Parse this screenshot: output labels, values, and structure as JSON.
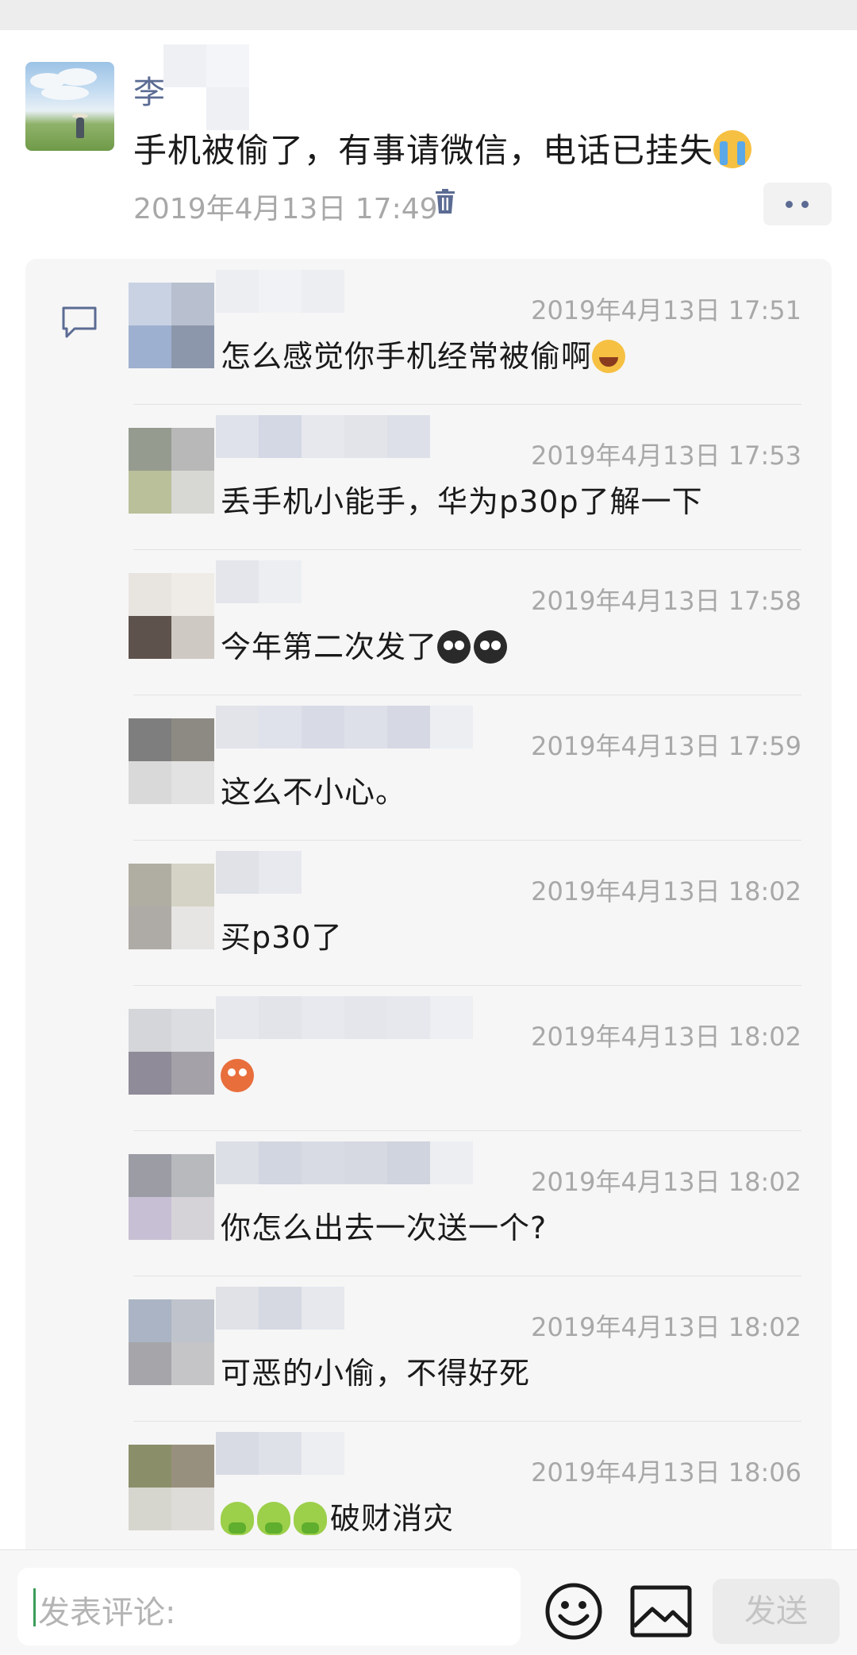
{
  "post": {
    "author": "李",
    "text": "手机被偷了，有事请微信，电话已挂失",
    "emoji": "loudly-crying-face",
    "time": "2019年4月13日 17:49"
  },
  "comments": [
    {
      "time": "2019年4月13日 17:51",
      "text": "怎么感觉你手机经常被偷啊",
      "emoji": [
        "face-with-tears-of-joy"
      ]
    },
    {
      "time": "2019年4月13日 17:53",
      "text": "丢手机小能手，华为p30p了解一下",
      "emoji": []
    },
    {
      "time": "2019年4月13日 17:58",
      "text": "今年第二次发了",
      "emoji": [
        "crying-face",
        "crying-face"
      ]
    },
    {
      "time": "2019年4月13日 17:59",
      "text": "这么不小心。",
      "emoji": []
    },
    {
      "time": "2019年4月13日 18:02",
      "text": "买p30了",
      "emoji": []
    },
    {
      "time": "2019年4月13日 18:02",
      "text": "",
      "emoji": [
        "orange-face"
      ]
    },
    {
      "time": "2019年4月13日 18:02",
      "text": "你怎么出去一次送一个?",
      "emoji": []
    },
    {
      "time": "2019年4月13日 18:02",
      "text": "可恶的小偷，不得好死",
      "emoji": []
    },
    {
      "time": "2019年4月13日 18:06",
      "text": "破财消灾",
      "emoji": [
        "green-figure",
        "green-figure",
        "green-figure"
      ]
    }
  ],
  "input": {
    "placeholder": "发表评论:",
    "send_label": "发送"
  },
  "colors": {
    "author": "#5b6b93",
    "timestamp": "#a8a8a8",
    "panel": "#f6f6f6"
  }
}
